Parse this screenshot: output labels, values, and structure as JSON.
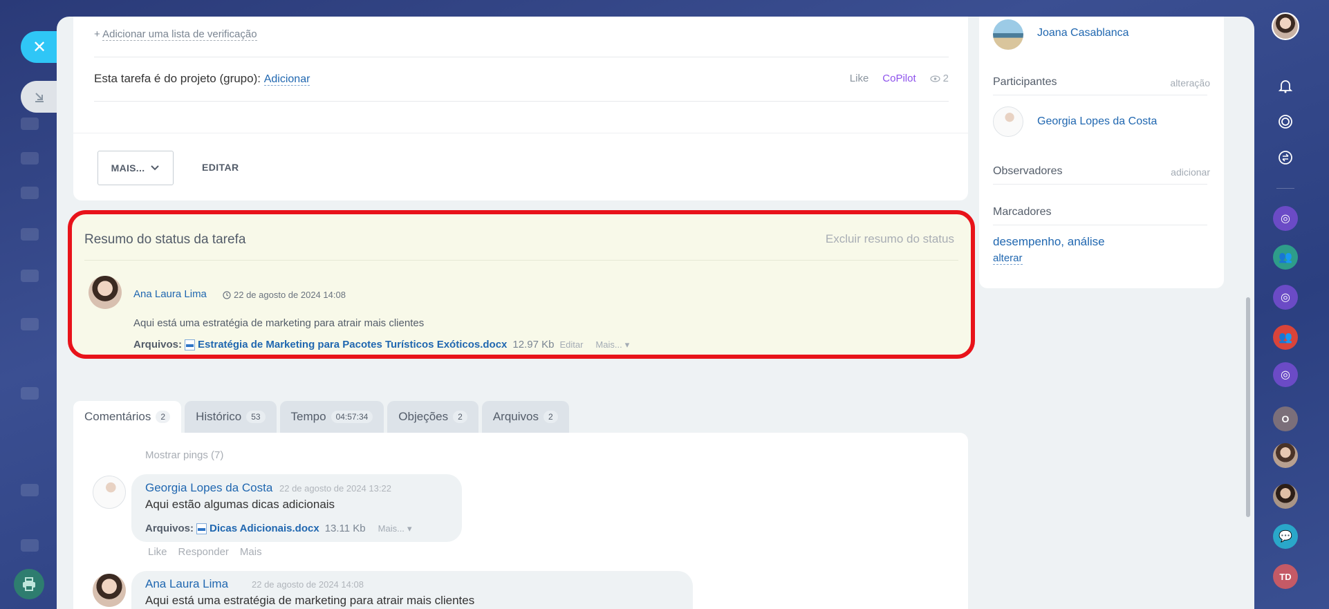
{
  "task": {
    "add_checklist_plus": "+",
    "add_checklist": "Adicionar uma lista de verificação",
    "project_label": "Esta tarefa é do projeto (grupo):",
    "project_add": "Adicionar",
    "like": "Like",
    "copilot": "CoPilot",
    "views": "2",
    "more_button": "MAIS...",
    "edit_button": "EDITAR"
  },
  "status_summary": {
    "title": "Resumo do status da tarefa",
    "delete": "Excluir resumo do status",
    "author": "Ana Laura Lima",
    "date": "22 de agosto de 2024 14:08",
    "text": "Aqui está uma estratégia de marketing para atrair mais clientes",
    "files_label": "Arquivos:",
    "file_name": "Estratégia de Marketing para Pacotes Turísticos Exóticos.docx",
    "file_size": "12.97 Kb",
    "file_edit": "Editar",
    "file_more": "Mais..."
  },
  "tabs": [
    {
      "label": "Comentários",
      "count": "2"
    },
    {
      "label": "Histórico",
      "count": "53"
    },
    {
      "label": "Tempo",
      "count": "04:57:34"
    },
    {
      "label": "Objeções",
      "count": "2"
    },
    {
      "label": "Arquivos",
      "count": "2"
    }
  ],
  "comments": {
    "show_pings": "Mostrar pings (7)",
    "items": [
      {
        "author": "Georgia Lopes da Costa",
        "date": "22 de agosto de 2024 13:22",
        "text": "Aqui estão algumas dicas adicionais",
        "files_label": "Arquivos:",
        "file_name": "Dicas Adicionais.docx",
        "file_size": "13.11 Kb",
        "file_more": "Mais...",
        "actions": [
          "Like",
          "Responder",
          "Mais"
        ]
      },
      {
        "author": "Ana Laura Lima",
        "date": "22 de agosto de 2024 14:08",
        "text": "Aqui está uma estratégia de marketing para atrair mais clientes"
      }
    ]
  },
  "sidebar": {
    "responsible_name": "Joana Casablanca",
    "participants_label": "Participantes",
    "participants_action": "alteração",
    "participant_name": "Georgia Lopes da Costa",
    "observers_label": "Observadores",
    "observers_action": "adicionar",
    "tags_label": "Marcadores",
    "tags_value": "desempenho, análise",
    "tags_action": "alterar"
  },
  "rail": {
    "avatar_o_letter": "O",
    "avatar_td_letters": "TD"
  },
  "colors": {
    "accent_blue": "#2067b0",
    "highlight_red": "#e8131a",
    "copilot_purple": "#8e52ec",
    "close_cyan": "#2fc6f6"
  }
}
